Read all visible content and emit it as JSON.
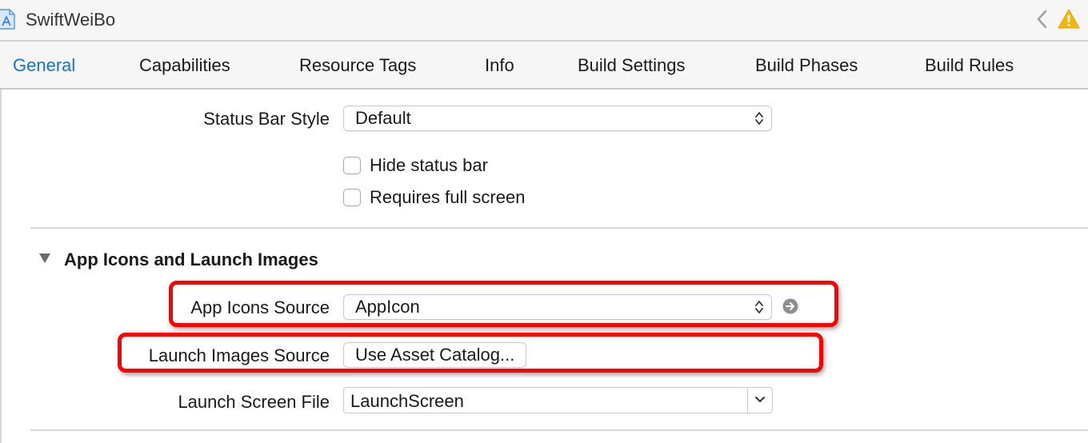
{
  "window": {
    "project_name": "SwiftWeiBo",
    "project_icon": "xcode-project-icon",
    "nav_icon": "chevron-left-icon",
    "warning_icon": "warning-triangle-icon"
  },
  "tabs": [
    {
      "label": "General",
      "active": true
    },
    {
      "label": "Capabilities",
      "active": false
    },
    {
      "label": "Resource Tags",
      "active": false
    },
    {
      "label": "Info",
      "active": false
    },
    {
      "label": "Build Settings",
      "active": false
    },
    {
      "label": "Build Phases",
      "active": false
    },
    {
      "label": "Build Rules",
      "active": false
    }
  ],
  "status_bar": {
    "label": "Status Bar Style",
    "value": "Default",
    "hide_label": "Hide status bar",
    "hide_checked": false,
    "fullscreen_label": "Requires full screen",
    "fullscreen_checked": false
  },
  "app_icons_section": {
    "title": "App Icons and Launch Images",
    "expanded": true,
    "app_icons_label": "App Icons Source",
    "app_icons_value": "AppIcon",
    "launch_images_label": "Launch Images Source",
    "launch_images_button": "Use Asset Catalog...",
    "launch_screen_label": "Launch Screen File",
    "launch_screen_value": "LaunchScreen"
  },
  "colors": {
    "accent": "#1a73c9",
    "highlight": "#ff0000",
    "warning": "#f5b800"
  }
}
